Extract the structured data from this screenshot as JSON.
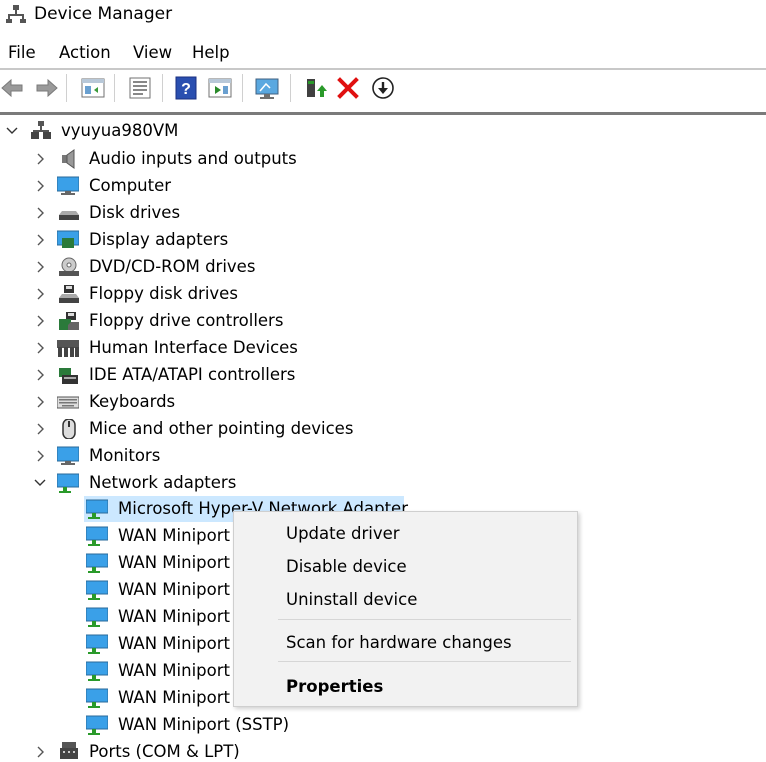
{
  "window": {
    "title": "Device Manager"
  },
  "menu": [
    "File",
    "Action",
    "View",
    "Help"
  ],
  "toolbar": {
    "buttons": [
      "back-arrow-icon",
      "forward-arrow-icon",
      "show-hide-tree-icon",
      "properties-icon",
      "help-icon",
      "run-icon",
      "monitor-scan-icon",
      "update-driver-icon",
      "uninstall-icon",
      "download-icon"
    ]
  },
  "tree": {
    "root": "vyuyua980VM",
    "categories": [
      {
        "label": "Audio inputs and outputs",
        "icon": "speaker-icon",
        "expanded": false
      },
      {
        "label": "Computer",
        "icon": "computer-icon",
        "expanded": false
      },
      {
        "label": "Disk drives",
        "icon": "disk-drive-icon",
        "expanded": false
      },
      {
        "label": "Display adapters",
        "icon": "display-adapter-icon",
        "expanded": false
      },
      {
        "label": "DVD/CD-ROM drives",
        "icon": "dvd-icon",
        "expanded": false
      },
      {
        "label": "Floppy disk drives",
        "icon": "floppy-icon",
        "expanded": false
      },
      {
        "label": "Floppy drive controllers",
        "icon": "floppy-controller-icon",
        "expanded": false
      },
      {
        "label": "Human Interface Devices",
        "icon": "hid-icon",
        "expanded": false
      },
      {
        "label": "IDE ATA/ATAPI controllers",
        "icon": "ide-controller-icon",
        "expanded": false
      },
      {
        "label": "Keyboards",
        "icon": "keyboard-icon",
        "expanded": false
      },
      {
        "label": "Mice and other pointing devices",
        "icon": "mouse-icon",
        "expanded": false
      },
      {
        "label": "Monitors",
        "icon": "monitor-icon",
        "expanded": false
      },
      {
        "label": "Network adapters",
        "icon": "network-adapter-icon",
        "expanded": true
      }
    ],
    "network_children": [
      "Microsoft Hyper-V Network Adapter",
      "WAN Miniport",
      "WAN Miniport",
      "WAN Miniport",
      "WAN Miniport",
      "WAN Miniport",
      "WAN Miniport",
      "WAN Miniport",
      "WAN Miniport (SSTP)"
    ],
    "after": {
      "label": "Ports (COM & LPT)",
      "icon": "port-icon",
      "expanded": false
    }
  },
  "context_menu": {
    "items": [
      "Update driver",
      "Disable device",
      "Uninstall device",
      "Scan for hardware changes",
      "Properties"
    ]
  },
  "colors": {
    "selection": "#cce8ff",
    "menu_bg": "#f2f2f2"
  }
}
